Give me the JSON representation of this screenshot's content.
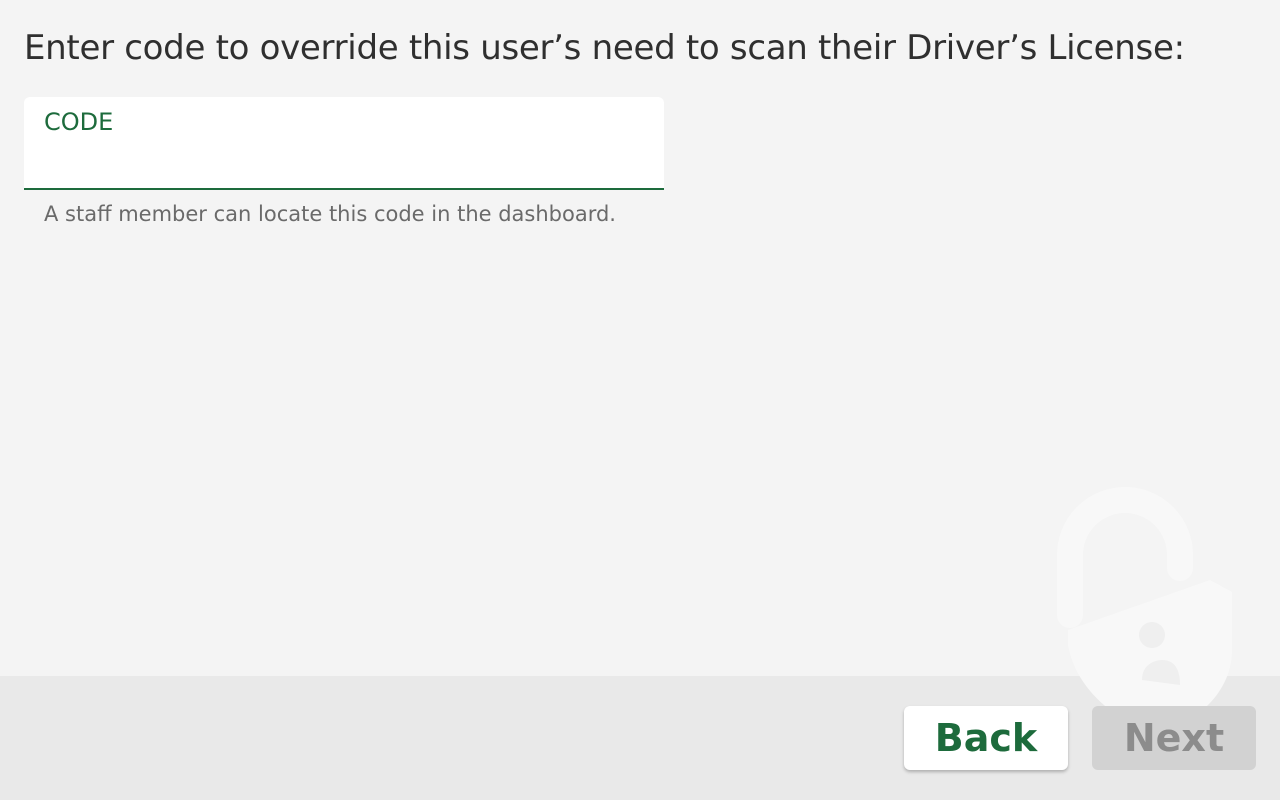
{
  "prompt": {
    "text": "Enter code to override this user’s need to scan their Driver’s License:"
  },
  "code_field": {
    "label": "CODE",
    "value": "",
    "helper": "A staff member can locate this code in the dashboard."
  },
  "footer": {
    "back_label": "Back",
    "next_label": "Next",
    "next_enabled": false
  },
  "icons": {
    "watermark": "unlocked-padlock-person-icon"
  },
  "colors": {
    "accent": "#1d6b3c",
    "background": "#f4f4f4",
    "footer_background": "#e9e9e9",
    "disabled_button": "#d2d2d2"
  }
}
